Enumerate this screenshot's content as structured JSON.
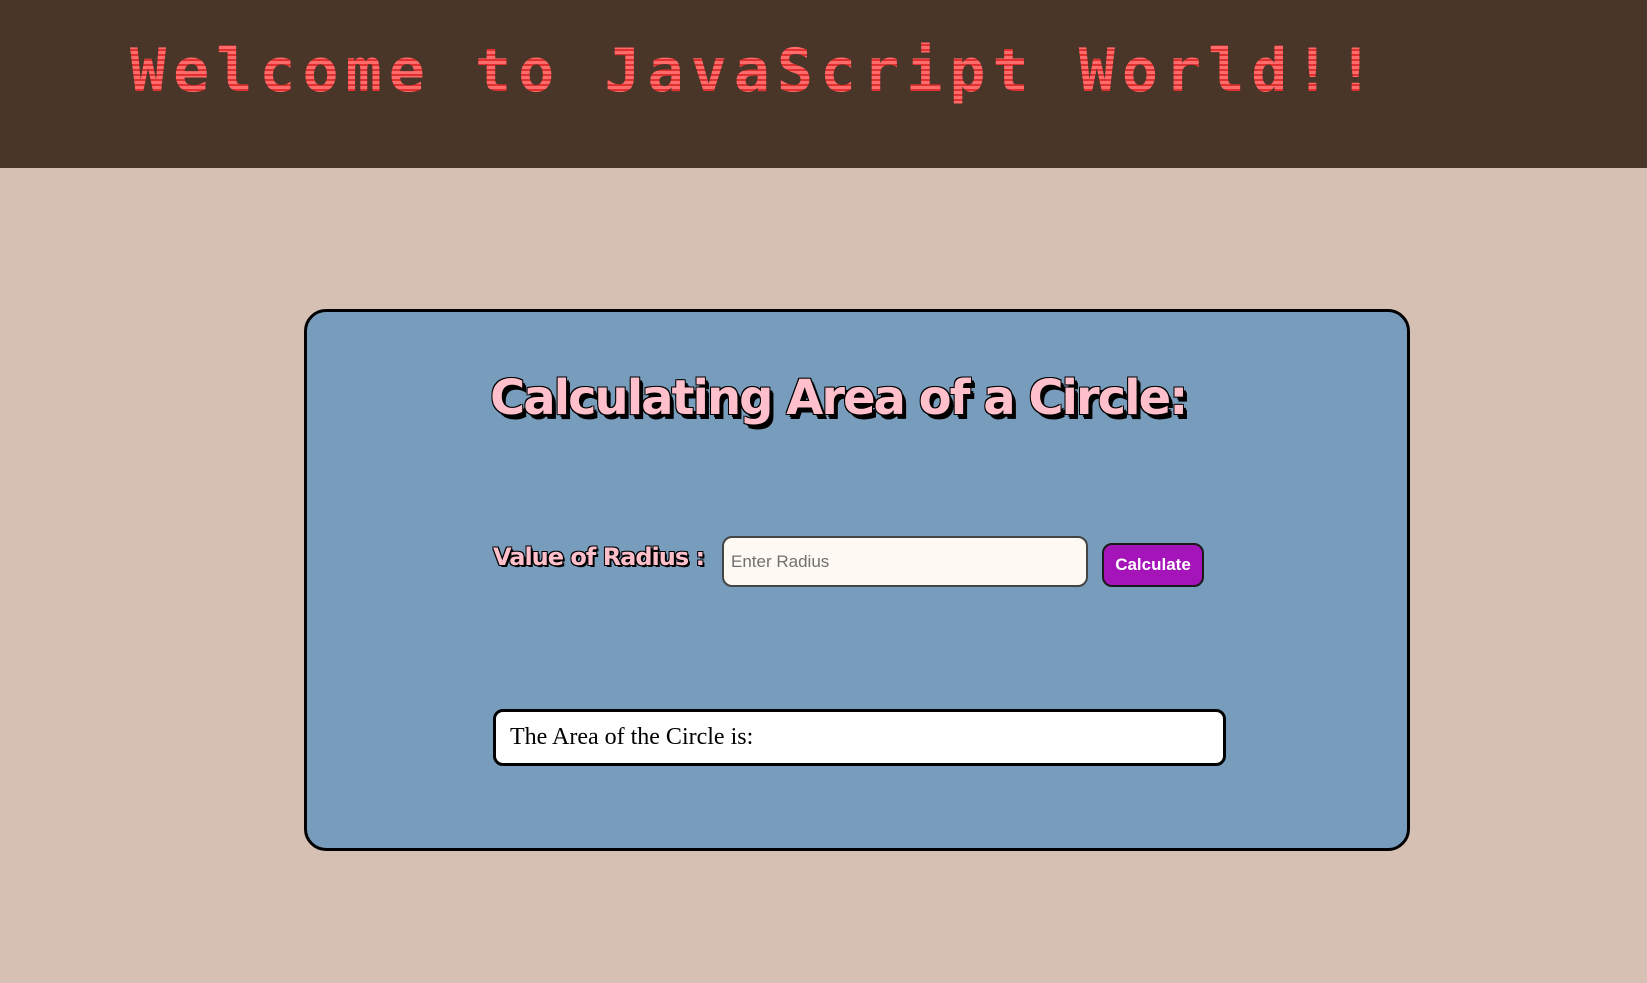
{
  "header": {
    "title": "Welcome to JavaScript World!!"
  },
  "calculator": {
    "title": "Calculating Area of a Circle:",
    "radius_label": "Value of Radius :",
    "radius_input": {
      "value": "",
      "placeholder": "Enter Radius"
    },
    "calculate_label": "Calculate",
    "result_label": "The Area of the Circle is:"
  },
  "colors": {
    "header_bg": "#493628",
    "page_bg": "#d6c0b3",
    "card_bg": "#789dbc",
    "title_pink": "#ffc0cb",
    "welcome_red": "#f04a4a",
    "button_purple": "#a414b8"
  }
}
